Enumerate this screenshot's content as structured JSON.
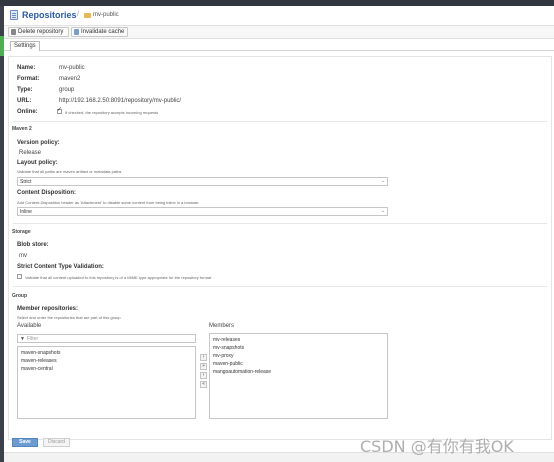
{
  "header": {
    "title": "Repositories",
    "separator": "/",
    "breadcrumb": "mv-public"
  },
  "toolbar": {
    "delete_label": "Delete repository",
    "invalidate_label": "Invalidate cache"
  },
  "tabs": [
    "Settings"
  ],
  "settings": {
    "name_label": "Name:",
    "name_value": "mv-public",
    "format_label": "Format:",
    "format_value": "maven2",
    "type_label": "Type:",
    "type_value": "group",
    "url_label": "URL:",
    "url_value": "http://192.168.2.50:8091/repository/mv-public/",
    "online_label": "Online:",
    "online_checked": true,
    "online_help": "If checked, the repository accepts incoming requests"
  },
  "maven2": {
    "section": "Maven 2",
    "version_policy_label": "Version policy:",
    "version_policy_value": "Release",
    "layout_policy_label": "Layout policy:",
    "layout_policy_help": "Validate that all paths are maven artifact or metadata paths",
    "layout_policy_value": "Strict",
    "content_disposition_label": "Content Disposition:",
    "content_disposition_help": "Add Content-Disposition header as 'Attachment' to disable some content from being inline in a browser.",
    "content_disposition_value": "Inline"
  },
  "storage": {
    "section": "Storage",
    "blob_store_label": "Blob store:",
    "blob_store_value": "mv",
    "strict_label": "Strict Content Type Validation:",
    "strict_checked": false,
    "strict_help": "Validate that all content uploaded to this repository is of a MIME type appropriate for the repository format"
  },
  "group": {
    "section": "Group",
    "members_label": "Member repositories:",
    "members_help": "Select and order the repositories that are part of this group",
    "available_label": "Available",
    "filter_placeholder": "Filter",
    "available": [
      "maven-snapshots",
      "maven-releases",
      "maven-central"
    ],
    "members_col_label": "Members",
    "members": [
      "mv-releases",
      "mv-snapshots",
      "mv-proxy",
      "maven-public",
      "mangoautomation-release"
    ]
  },
  "footer": {
    "save_label": "Save",
    "discard_label": "Discard"
  },
  "watermark": "CSDN @有你有我OK",
  "colors": {
    "brand_title": "#2b5ba6",
    "primary_button": "#6b9bd1",
    "nav_accent": "#4caf50"
  },
  "icons": {
    "repository": "repository-icon",
    "folder": "folder-icon",
    "delete": "delete-icon",
    "cache": "cache-icon",
    "filter": "filter-icon"
  }
}
